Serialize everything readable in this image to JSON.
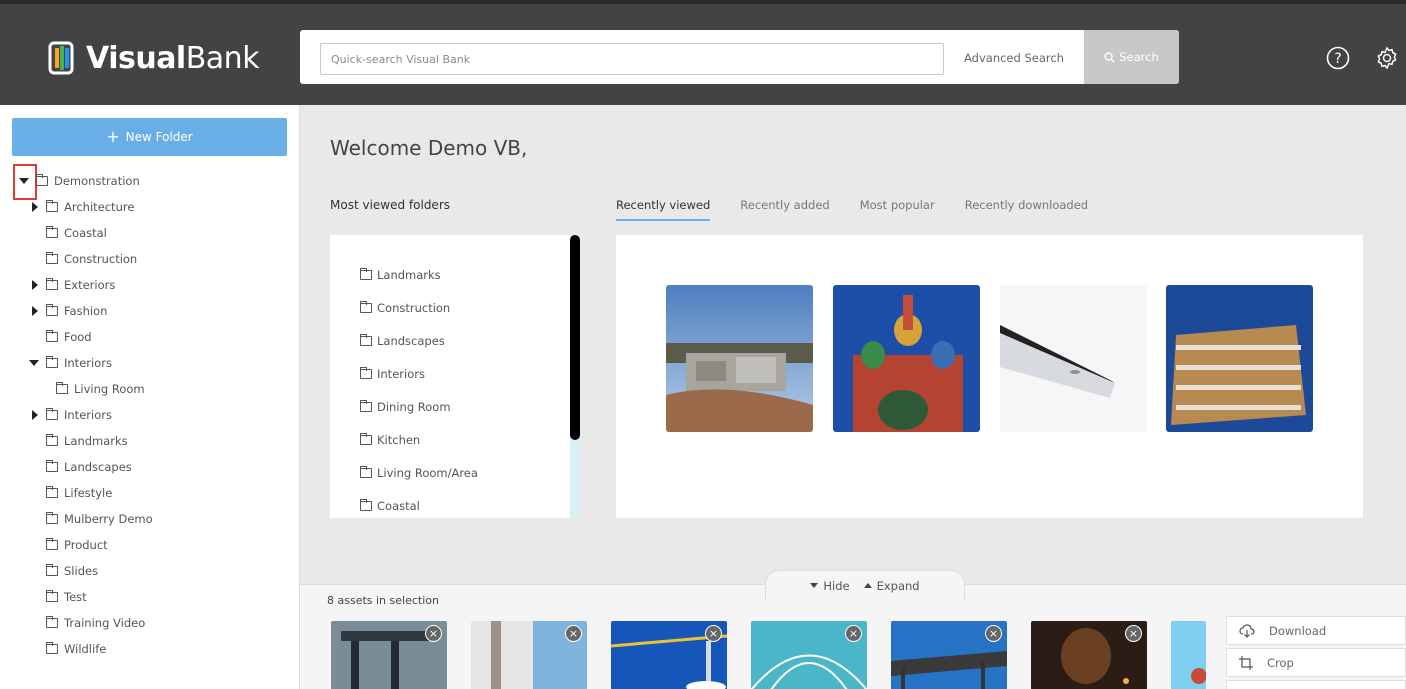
{
  "header": {
    "logo_bold": "Visual",
    "logo_light": "Bank",
    "search_placeholder": "Quick-search Visual Bank",
    "advanced_search": "Advanced Search",
    "search_button": "Search"
  },
  "sidebar": {
    "new_folder": "New Folder",
    "tree": [
      {
        "label": "Demonstration",
        "expanded": true
      },
      {
        "label": "Architecture",
        "expanded": false
      },
      {
        "label": "Coastal"
      },
      {
        "label": "Construction"
      },
      {
        "label": "Exteriors",
        "expanded": false
      },
      {
        "label": "Fashion",
        "expanded": false
      },
      {
        "label": "Food"
      },
      {
        "label": "Interiors",
        "expanded": true
      },
      {
        "label": "Living Room"
      },
      {
        "label": "Interiors",
        "expanded": false
      },
      {
        "label": "Landmarks"
      },
      {
        "label": "Landscapes"
      },
      {
        "label": "Lifestyle"
      },
      {
        "label": "Mulberry Demo"
      },
      {
        "label": "Product"
      },
      {
        "label": "Slides"
      },
      {
        "label": "Test"
      },
      {
        "label": "Training Video"
      },
      {
        "label": "Wildlife"
      }
    ]
  },
  "main": {
    "welcome": "Welcome Demo VB,",
    "most_viewed_title": "Most viewed folders",
    "most_viewed": [
      "Landmarks",
      "Construction",
      "Landscapes",
      "Interiors",
      "Dining Room",
      "Kitchen",
      "Living Room/Area",
      "Coastal"
    ],
    "tabs": [
      "Recently viewed",
      "Recently added",
      "Most popular",
      "Recently downloaded"
    ],
    "active_tab": "Recently viewed"
  },
  "tray": {
    "hide": "Hide",
    "expand": "Expand",
    "count": "8 assets in selection",
    "actions": [
      "Download",
      "Crop"
    ]
  },
  "colors": {
    "accent": "#6aaee8",
    "header_bg": "#434343",
    "highlight": "#e53935"
  }
}
